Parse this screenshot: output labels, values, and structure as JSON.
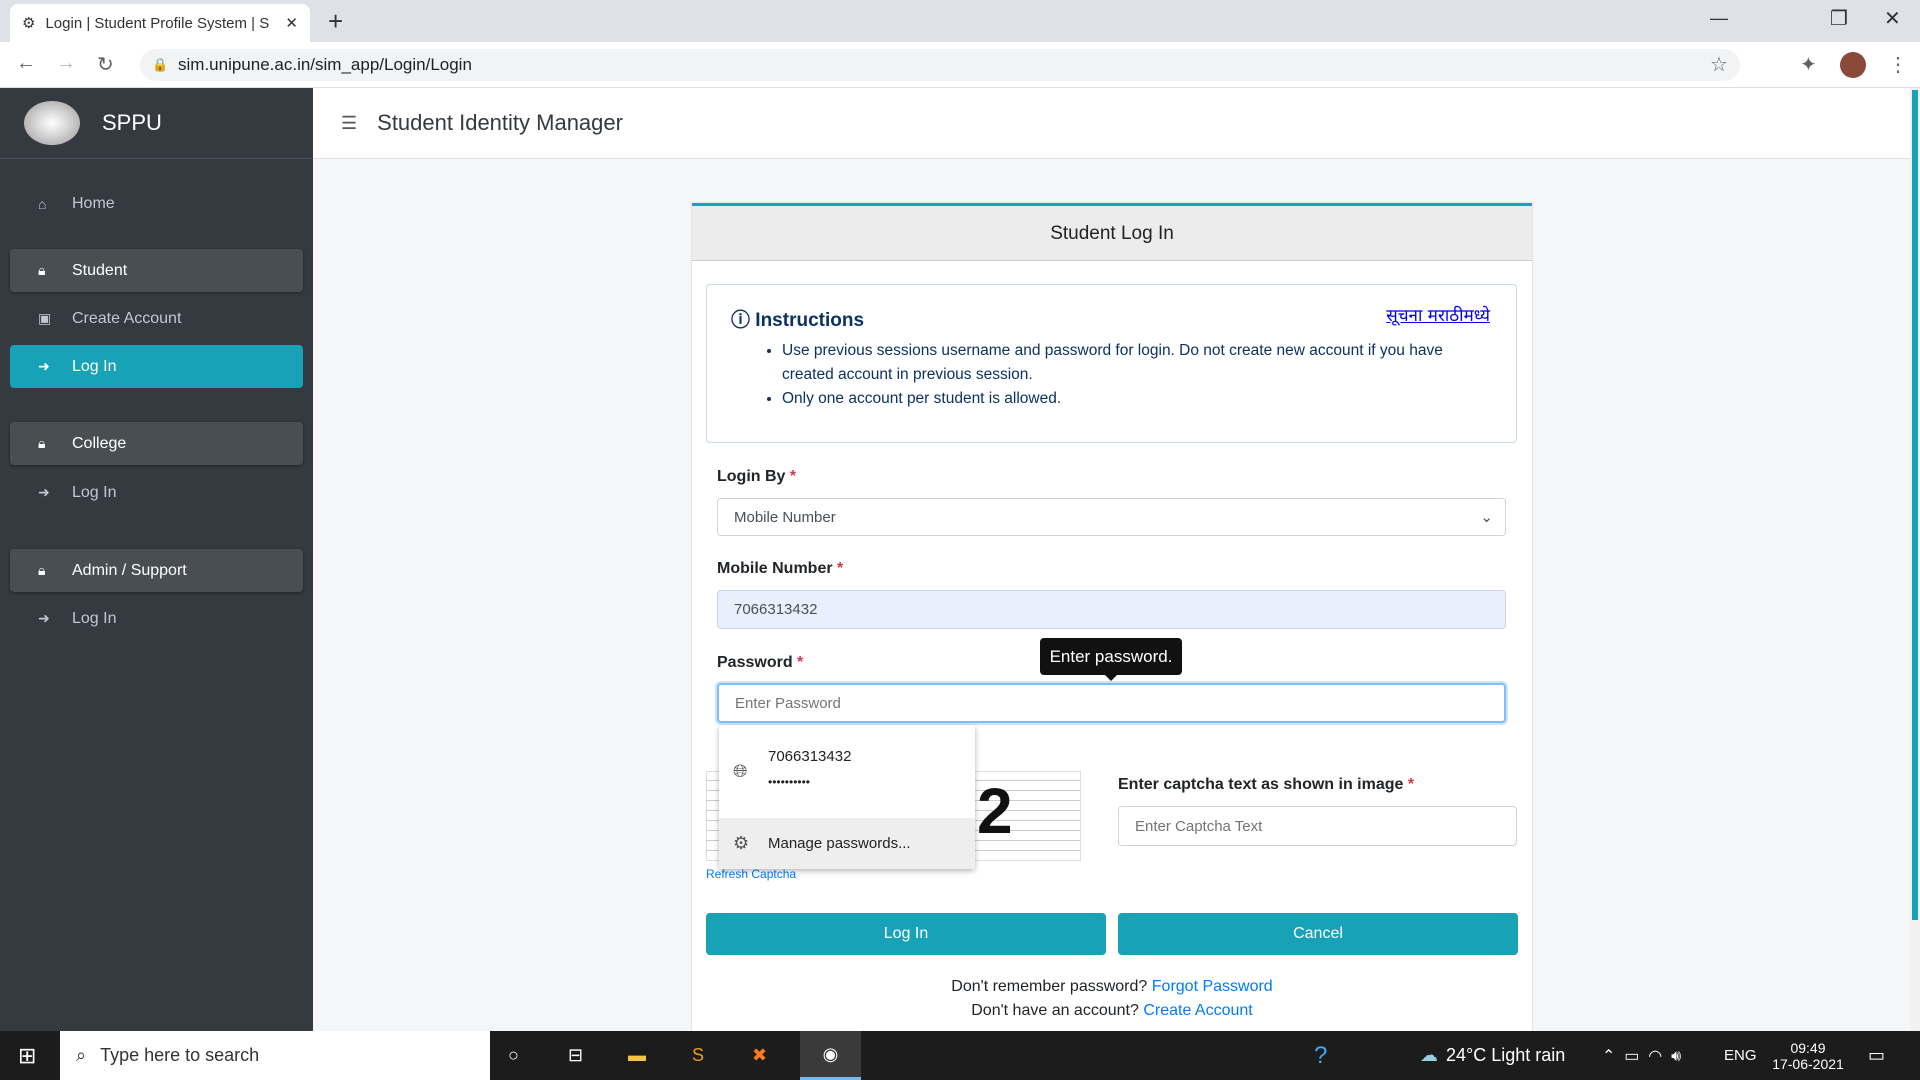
{
  "browser": {
    "tab_title": "Login | Student Profile System | S",
    "url": "sim.unipune.ac.in/sim_app/Login/Login"
  },
  "sidebar": {
    "brand": "SPPU",
    "items": [
      {
        "label": "Home",
        "icon": "home-icon"
      },
      {
        "label": "Student",
        "icon": "lock-icon"
      },
      {
        "label": "Create Account",
        "icon": "id-card-icon"
      },
      {
        "label": "Log In",
        "icon": "sign-in-icon"
      },
      {
        "label": "College",
        "icon": "lock-icon"
      },
      {
        "label": "Log In",
        "icon": "sign-in-icon"
      },
      {
        "label": "Admin / Support",
        "icon": "lock-icon"
      },
      {
        "label": "Log In",
        "icon": "sign-in-icon"
      }
    ]
  },
  "header": {
    "title": "Student Identity Manager"
  },
  "card": {
    "title": "Student Log In",
    "instructions": {
      "title": "Instructions",
      "marathi_link": "सूचना मराठीमध्ये",
      "items": [
        "Use previous sessions username and password for login. Do not create new account if you have created account in previous session.",
        "Only one account per student is allowed."
      ]
    },
    "login_by": {
      "label": "Login By",
      "value": "Mobile Number"
    },
    "mobile": {
      "label": "Mobile Number",
      "value": "7066313432"
    },
    "password": {
      "label": "Password",
      "placeholder": "Enter Password",
      "tooltip": "Enter password."
    },
    "autofill": {
      "username": "7066313432",
      "password": "••••••••••",
      "manage": "Manage passwords..."
    },
    "captcha": {
      "label": "Enter captcha text as shown in image",
      "placeholder": "Enter Captcha Text",
      "refresh": "Refresh Captcha",
      "visible_char": "2"
    },
    "login_button": "Log In",
    "cancel_button": "Cancel",
    "forgot_text": "Don't remember password?",
    "forgot_link": "Forgot Password",
    "create_text": "Don't have an account?",
    "create_link": "Create Account",
    "required": "*"
  },
  "taskbar": {
    "search": "Type here to search",
    "weather": "24°C  Light rain",
    "lang": "ENG",
    "time": "09:49",
    "date": "17-06-2021"
  }
}
